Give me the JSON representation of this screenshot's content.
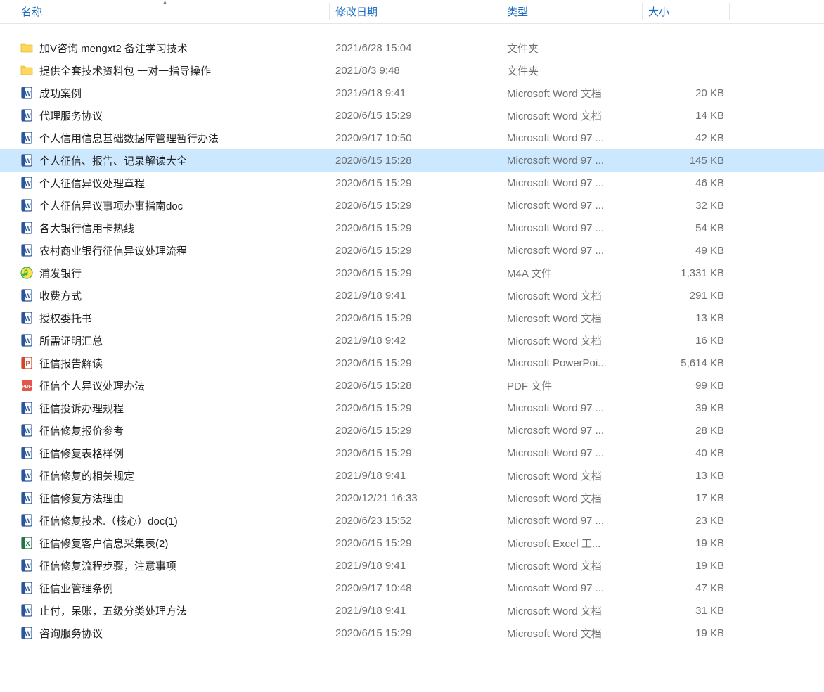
{
  "columns": {
    "name": "名称",
    "date": "修改日期",
    "type": "类型",
    "size": "大小"
  },
  "icons": {
    "folder": "folder",
    "word": "word",
    "word97": "word97",
    "excel": "excel",
    "ppt": "ppt",
    "pdf": "pdf",
    "m4a": "m4a"
  },
  "selected_index": 5,
  "files": [
    {
      "icon": "folder",
      "name": "加V咨询   mengxt2  备注学习技术",
      "date": "2021/6/28 15:04",
      "type": "文件夹",
      "size": ""
    },
    {
      "icon": "folder",
      "name": "提供全套技术资料包 一对一指导操作",
      "date": "2021/8/3 9:48",
      "type": "文件夹",
      "size": ""
    },
    {
      "icon": "word",
      "name": "成功案例",
      "date": "2021/9/18 9:41",
      "type": "Microsoft Word 文档",
      "size": "20 KB"
    },
    {
      "icon": "word",
      "name": "代理服务协议",
      "date": "2020/6/15 15:29",
      "type": "Microsoft Word 文档",
      "size": "14 KB"
    },
    {
      "icon": "word97",
      "name": "个人信用信息基础数据库管理暂行办法",
      "date": "2020/9/17 10:50",
      "type": "Microsoft Word 97 ...",
      "size": "42 KB"
    },
    {
      "icon": "word97",
      "name": "个人征信、报告、记录解读大全",
      "date": "2020/6/15 15:28",
      "type": "Microsoft Word 97 ...",
      "size": "145 KB"
    },
    {
      "icon": "word97",
      "name": "个人征信异议处理章程",
      "date": "2020/6/15 15:29",
      "type": "Microsoft Word 97 ...",
      "size": "46 KB"
    },
    {
      "icon": "word97",
      "name": "个人征信异议事项办事指南doc",
      "date": "2020/6/15 15:29",
      "type": "Microsoft Word 97 ...",
      "size": "32 KB"
    },
    {
      "icon": "word97",
      "name": "各大银行信用卡热线",
      "date": "2020/6/15 15:29",
      "type": "Microsoft Word 97 ...",
      "size": "54 KB"
    },
    {
      "icon": "word97",
      "name": "农村商业银行征信异议处理流程",
      "date": "2020/6/15 15:29",
      "type": "Microsoft Word 97 ...",
      "size": "49 KB"
    },
    {
      "icon": "m4a",
      "name": "浦发银行",
      "date": "2020/6/15 15:29",
      "type": "M4A 文件",
      "size": "1,331 KB"
    },
    {
      "icon": "word",
      "name": "收费方式",
      "date": "2021/9/18 9:41",
      "type": "Microsoft Word 文档",
      "size": "291 KB"
    },
    {
      "icon": "word",
      "name": "授权委托书",
      "date": "2020/6/15 15:29",
      "type": "Microsoft Word 文档",
      "size": "13 KB"
    },
    {
      "icon": "word",
      "name": "所需证明汇总",
      "date": "2021/9/18 9:42",
      "type": "Microsoft Word 文档",
      "size": "16 KB"
    },
    {
      "icon": "ppt",
      "name": "征信报告解读",
      "date": "2020/6/15 15:29",
      "type": "Microsoft PowerPoi...",
      "size": "5,614 KB"
    },
    {
      "icon": "pdf",
      "name": "征信个人异议处理办法",
      "date": "2020/6/15 15:28",
      "type": "PDF 文件",
      "size": "99 KB"
    },
    {
      "icon": "word97",
      "name": "征信投诉办理规程",
      "date": "2020/6/15 15:29",
      "type": "Microsoft Word 97 ...",
      "size": "39 KB"
    },
    {
      "icon": "word97",
      "name": "征信修复报价参考",
      "date": "2020/6/15 15:29",
      "type": "Microsoft Word 97 ...",
      "size": "28 KB"
    },
    {
      "icon": "word97",
      "name": "征信修复表格样例",
      "date": "2020/6/15 15:29",
      "type": "Microsoft Word 97 ...",
      "size": "40 KB"
    },
    {
      "icon": "word",
      "name": "征信修复的相关规定",
      "date": "2021/9/18 9:41",
      "type": "Microsoft Word 文档",
      "size": "13 KB"
    },
    {
      "icon": "word",
      "name": "征信修复方法理由",
      "date": "2020/12/21 16:33",
      "type": "Microsoft Word 文档",
      "size": "17 KB"
    },
    {
      "icon": "word97",
      "name": "征信修复技术.（核心）doc(1)",
      "date": "2020/6/23 15:52",
      "type": "Microsoft Word 97 ...",
      "size": "23 KB"
    },
    {
      "icon": "excel",
      "name": "征信修复客户信息采集表(2)",
      "date": "2020/6/15 15:29",
      "type": "Microsoft Excel 工...",
      "size": "19 KB"
    },
    {
      "icon": "word",
      "name": "征信修复流程步骤，注意事项",
      "date": "2021/9/18 9:41",
      "type": "Microsoft Word 文档",
      "size": "19 KB"
    },
    {
      "icon": "word97",
      "name": "征信业管理条例",
      "date": "2020/9/17 10:48",
      "type": "Microsoft Word 97 ...",
      "size": "47 KB"
    },
    {
      "icon": "word",
      "name": "止付，呆账，五级分类处理方法",
      "date": "2021/9/18 9:41",
      "type": "Microsoft Word 文档",
      "size": "31 KB"
    },
    {
      "icon": "word",
      "name": "咨询服务协议",
      "date": "2020/6/15 15:29",
      "type": "Microsoft Word 文档",
      "size": "19 KB"
    }
  ]
}
